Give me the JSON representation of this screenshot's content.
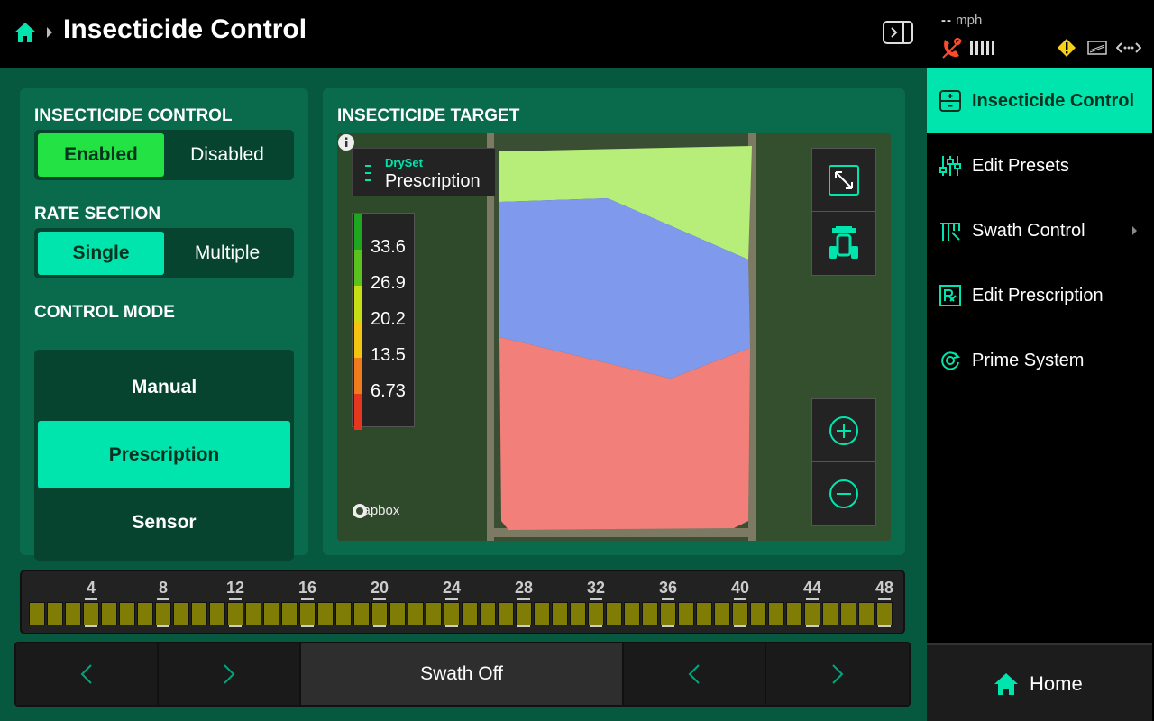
{
  "header": {
    "title": "Insecticide Control",
    "icons": {
      "home": "home-icon",
      "breadcrumb": "chevron-right-icon",
      "panel_toggle": "panel-toggle-icon"
    }
  },
  "status": {
    "speed_value": "--",
    "speed_unit": "mph",
    "icons": [
      "gps-icon",
      "signal-bars-icon",
      "warning-icon",
      "bmp-icon",
      "link-icon"
    ]
  },
  "control_card": {
    "insecticide_label": "INSECTICIDE CONTROL",
    "enabled_label": "Enabled",
    "disabled_label": "Disabled",
    "enabled_selected": true,
    "rate_label": "RATE SECTION",
    "single_label": "Single",
    "multiple_label": "Multiple",
    "rate_selected": "Single",
    "mode_label": "CONTROL MODE",
    "modes": [
      "Manual",
      "Prescription",
      "Sensor"
    ],
    "mode_selected": "Prescription"
  },
  "target_card": {
    "title": "INSECTICIDE TARGET",
    "layer_sub": "DrySet",
    "layer_main": "Prescription",
    "legend": [
      {
        "label": "33.6",
        "color": "#1fa61f"
      },
      {
        "label": "26.9",
        "color": "#59c21c"
      },
      {
        "label": "20.2",
        "color": "#c6df12"
      },
      {
        "label": "13.5",
        "color": "#f3c511"
      },
      {
        "label": "6.73",
        "color": "#ef7b1c"
      },
      {
        "label": "",
        "color": "#e5361e"
      }
    ],
    "zones": {
      "top": "#b7ee7a",
      "middle": "#7f99ec",
      "bottom": "#f27f7a"
    },
    "mapbox_label": "mapbox",
    "icons": [
      "fullscreen-icon",
      "tractor-icon",
      "zoom-in-icon",
      "zoom-out-icon",
      "info-icon"
    ]
  },
  "swath": {
    "numbers": [
      "4",
      "8",
      "12",
      "16",
      "20",
      "24",
      "28",
      "32",
      "36",
      "40",
      "44",
      "48"
    ],
    "box_count": 48,
    "box_color": "#7f7d06"
  },
  "bottom_nav": {
    "center_label": "Swath Off",
    "icons": [
      "chevron-left-icon",
      "chevron-right-icon",
      "chevron-left-icon",
      "chevron-right-icon"
    ]
  },
  "sidebar": {
    "items": [
      {
        "label": "Insecticide Control",
        "icon": "insecticide-control-icon",
        "active": true
      },
      {
        "label": "Edit Presets",
        "icon": "edit-presets-icon",
        "active": false
      },
      {
        "label": "Swath Control",
        "icon": "swath-control-icon",
        "active": false,
        "has_submenu": true
      },
      {
        "label": "Edit Prescription",
        "icon": "edit-prescription-icon",
        "active": false
      },
      {
        "label": "Prime System",
        "icon": "prime-system-icon",
        "active": false
      }
    ],
    "home_label": "Home"
  },
  "colors": {
    "accent": "#00e5ad",
    "enabled": "#23e244",
    "background": "#06583e",
    "card": "#0a6b4c"
  }
}
